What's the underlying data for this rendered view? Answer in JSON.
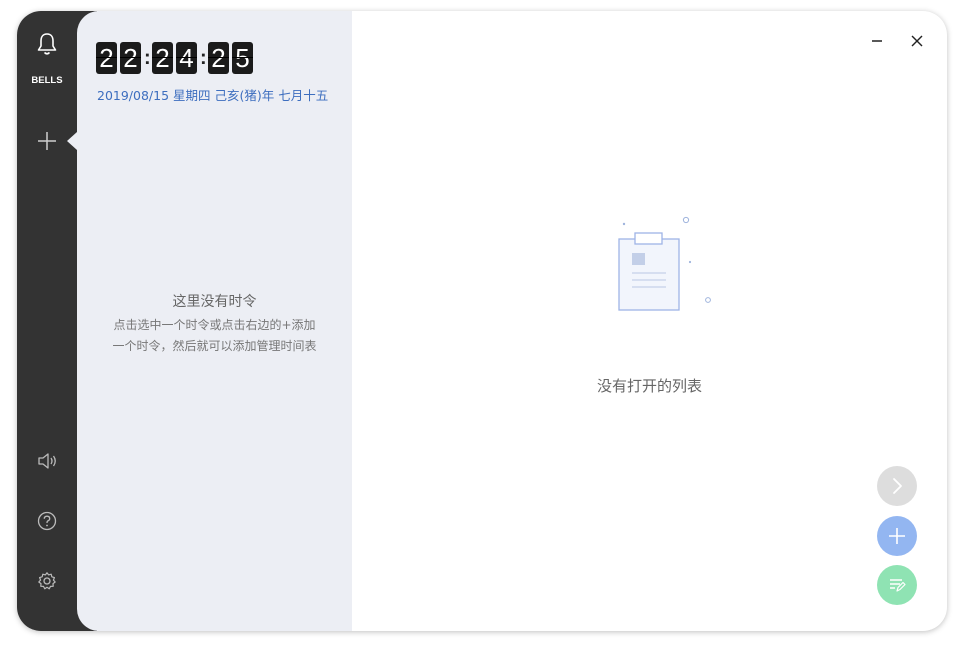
{
  "app": {
    "name": "BELLS"
  },
  "sidebar": {
    "brand_icon": "bell-icon",
    "add_icon": "plus-icon",
    "bottom_icons": [
      "speaker-icon",
      "help-icon",
      "gear-icon"
    ]
  },
  "clock": {
    "digits": [
      "2",
      "2",
      "2",
      "4",
      "2",
      "5"
    ],
    "time": "22:24:25"
  },
  "date": {
    "text": "2019/08/15 星期四 己亥(猪)年 七月十五"
  },
  "left_empty": {
    "title": "这里没有时令",
    "line1": "点击选中一个时令或点击右边的+添加",
    "line2": "一个时令，然后就可以添加管理时间表"
  },
  "window_controls": {
    "minimize_icon": "minimize-icon",
    "close_icon": "close-icon"
  },
  "main_empty": {
    "icon": "clipboard-icon",
    "text": "没有打开的列表"
  },
  "fabs": [
    {
      "icon": "chevron-right-icon",
      "color": "#dddddd"
    },
    {
      "icon": "plus-icon",
      "color": "#93b6f1"
    },
    {
      "icon": "list-edit-icon",
      "color": "#8fe3b3"
    }
  ],
  "colors": {
    "rail": "#333333",
    "panel": "#eceef4",
    "date_text": "#3d6ebf",
    "accent_blue": "#93b6f1",
    "accent_green": "#8fe3b3"
  }
}
